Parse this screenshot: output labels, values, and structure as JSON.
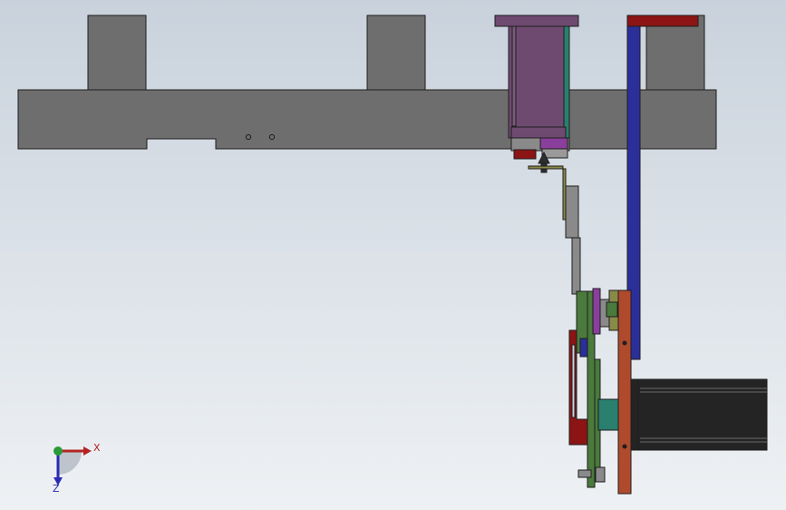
{
  "view": {
    "background_top": "#c9d2dc",
    "background_bottom": "#eef1f4",
    "part_fill": "#6e6e6e",
    "edge_color": "#1e1e1e"
  },
  "triad": {
    "x_label": "X",
    "z_label": "Z",
    "x_color": "#b42424",
    "y_color": "#2a9a3a",
    "z_color": "#2a2ab4"
  },
  "colors": {
    "purple": "#6e4a70",
    "magenta": "#8a3f9c",
    "green": "#4a7a3c",
    "teal": "#2a7f6f",
    "blue": "#2b2f9a",
    "red": "#8c1414",
    "orange": "#b04a2c",
    "black_motor": "#242424",
    "olive": "#8a8a48",
    "grey_plate": "#8a8a8a"
  }
}
